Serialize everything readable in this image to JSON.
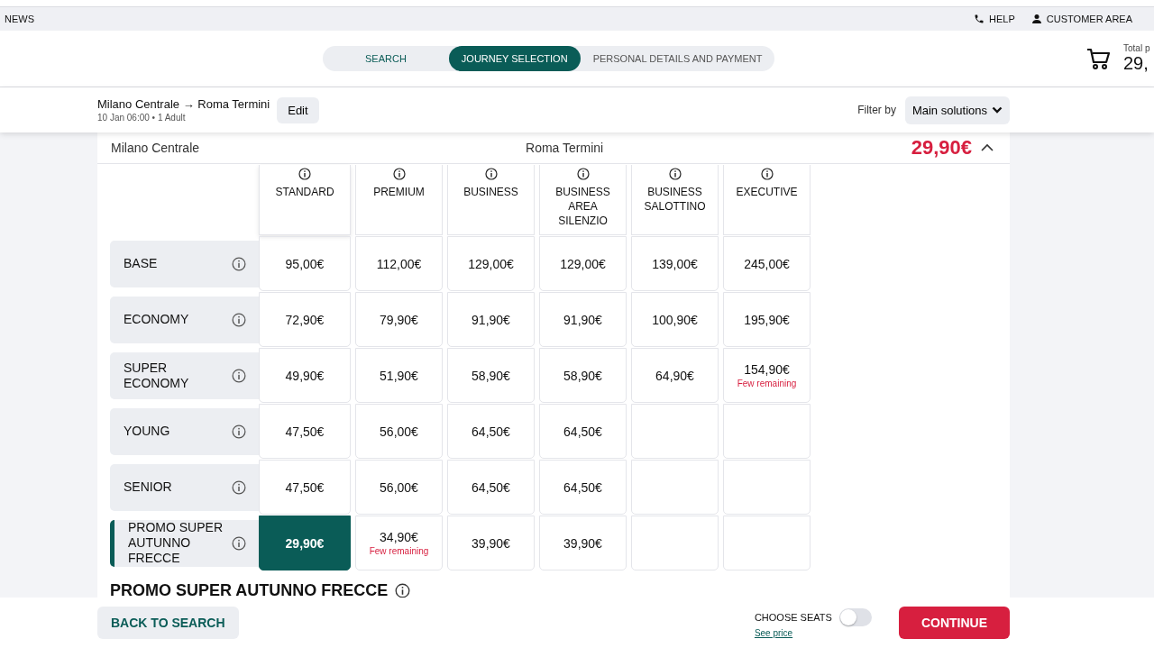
{
  "top_bar": {
    "news": "NEWS",
    "help": "HELP",
    "customer_area": "CUSTOMER AREA"
  },
  "steps": [
    {
      "label": "SEARCH",
      "selected": false,
      "completed": true
    },
    {
      "label": "JOURNEY SELECTION",
      "selected": true,
      "completed": false
    },
    {
      "label": "PERSONAL DETAILS AND PAYMENT",
      "selected": false,
      "completed": false
    }
  ],
  "cart": {
    "label": "Total p",
    "amount": "29,"
  },
  "journey": {
    "route": "Milano Centrale → Roma Termini",
    "details": "10 Jan 06:00 • 1 Adult",
    "edit": "Edit"
  },
  "filter": {
    "label": "Filter by",
    "value": "Main solutions"
  },
  "solution": {
    "from": "Milano Centrale",
    "to": "Roma Termini",
    "price": "29,90€",
    "expanded": true
  },
  "columns": [
    "STANDARD",
    "PREMIUM",
    "BUSINESS",
    "BUSINESS AREA SILENZIO",
    "BUSINESS SALOTTINO",
    "EXECUTIVE"
  ],
  "rows": [
    {
      "label": "BASE",
      "selected": false,
      "cells": [
        {
          "kind": "price",
          "price": "95,00€",
          "selected": false
        },
        {
          "kind": "price",
          "price": "112,00€",
          "selected": false
        },
        {
          "kind": "price",
          "price": "129,00€",
          "selected": false
        },
        {
          "kind": "price",
          "price": "129,00€",
          "selected": false
        },
        {
          "kind": "price",
          "price": "139,00€",
          "selected": false
        },
        {
          "kind": "price",
          "price": "245,00€",
          "selected": false
        }
      ]
    },
    {
      "label": "ECONOMY",
      "selected": false,
      "cells": [
        {
          "kind": "price",
          "price": "72,90€",
          "selected": false
        },
        {
          "kind": "price",
          "price": "79,90€",
          "selected": false
        },
        {
          "kind": "price",
          "price": "91,90€",
          "selected": false
        },
        {
          "kind": "price",
          "price": "91,90€",
          "selected": false
        },
        {
          "kind": "price",
          "price": "100,90€",
          "selected": false
        },
        {
          "kind": "price",
          "price": "195,90€",
          "selected": false
        }
      ]
    },
    {
      "label": "SUPER ECONOMY",
      "selected": false,
      "cells": [
        {
          "kind": "price",
          "price": "49,90€",
          "selected": false
        },
        {
          "kind": "price",
          "price": "51,90€",
          "selected": false
        },
        {
          "kind": "price",
          "price": "58,90€",
          "selected": false
        },
        {
          "kind": "price",
          "price": "58,90€",
          "selected": false
        },
        {
          "kind": "price",
          "price": "64,90€",
          "selected": false
        },
        {
          "kind": "price",
          "price": "154,90€",
          "selected": false,
          "note": "Few remaining"
        }
      ]
    },
    {
      "label": "YOUNG",
      "selected": false,
      "cells": [
        {
          "kind": "price",
          "price": "47,50€",
          "selected": false
        },
        {
          "kind": "price",
          "price": "56,00€",
          "selected": false
        },
        {
          "kind": "price",
          "price": "64,50€",
          "selected": false
        },
        {
          "kind": "price",
          "price": "64,50€",
          "selected": false
        },
        {
          "kind": "empty"
        },
        {
          "kind": "empty"
        }
      ]
    },
    {
      "label": "SENIOR",
      "selected": false,
      "cells": [
        {
          "kind": "price",
          "price": "47,50€",
          "selected": false
        },
        {
          "kind": "price",
          "price": "56,00€",
          "selected": false
        },
        {
          "kind": "price",
          "price": "64,50€",
          "selected": false
        },
        {
          "kind": "price",
          "price": "64,50€",
          "selected": false
        },
        {
          "kind": "empty"
        },
        {
          "kind": "empty"
        }
      ]
    },
    {
      "label": "PROMO SUPER AUTUNNO FRECCE",
      "selected": true,
      "cells": [
        {
          "kind": "price",
          "price": "29,90€",
          "selected": true
        },
        {
          "kind": "price",
          "price": "34,90€",
          "selected": false,
          "note": "Few remaining"
        },
        {
          "kind": "price",
          "price": "39,90€",
          "selected": false
        },
        {
          "kind": "price",
          "price": "39,90€",
          "selected": false
        },
        {
          "kind": "empty"
        },
        {
          "kind": "empty"
        }
      ]
    }
  ],
  "offer_heading": "PROMO SUPER AUTUNNO FRECCE",
  "footer": {
    "back": "BACK TO SEARCH",
    "choose_seats": "CHOOSE SEATS",
    "choose_seats_on": false,
    "see_price": "See price",
    "continue": "CONTINUE"
  }
}
